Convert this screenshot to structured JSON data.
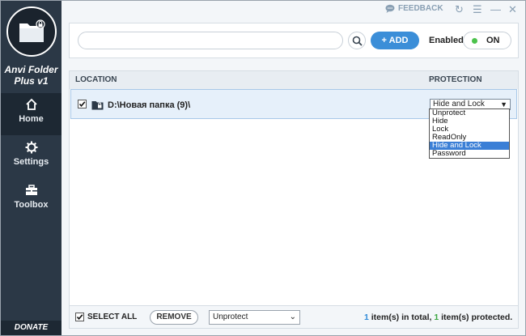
{
  "app": {
    "name_line1": "Anvi Folder",
    "name_line2": "Plus v1",
    "donate": "DONATE"
  },
  "titlebar": {
    "feedback": "FEEDBACK"
  },
  "sidebar": {
    "items": [
      {
        "label": "Home",
        "icon": "home-icon",
        "active": true
      },
      {
        "label": "Settings",
        "icon": "gear-icon",
        "active": false
      },
      {
        "label": "Toolbox",
        "icon": "toolbox-icon",
        "active": false
      }
    ]
  },
  "toolbar": {
    "search_value": "",
    "add_label": "+ ADD",
    "enabled_label": "Enabled",
    "toggle_label": "ON"
  },
  "list": {
    "columns": {
      "location": "LOCATION",
      "method": "PROTECTION METHOD"
    },
    "rows": [
      {
        "checked": true,
        "path": "D:\\Новая папка (9)\\",
        "method": "Hide and Lock"
      }
    ],
    "dropdown_options": [
      "Unprotect",
      "Hide",
      "Lock",
      "ReadOnly",
      "Hide and Lock",
      "Password"
    ],
    "dropdown_selected": "Hide and Lock"
  },
  "footer": {
    "select_all": "SELECT ALL",
    "remove": "REMOVE",
    "bulk_method": "Unprotect",
    "total_count": "1",
    "total_text": " item(s) in total, ",
    "protected_count": "1",
    "protected_text": " item(s) protected."
  },
  "colors": {
    "sidebar": "#2b3846",
    "accent": "#3b8ed8",
    "enabled_dot": "#4cc24c"
  }
}
